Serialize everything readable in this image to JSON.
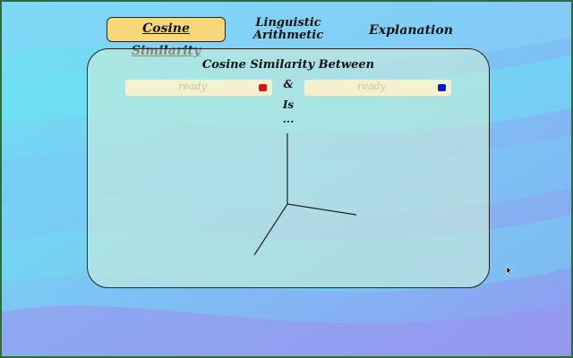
{
  "tabs": [
    {
      "label": "Cosine Similarity",
      "active": true
    },
    {
      "label": "Linguistic Arithmetic",
      "active": false
    },
    {
      "label": "Explanation",
      "active": false
    }
  ],
  "panel": {
    "title": "Cosine Similarity Between",
    "word1": {
      "placeholder": "ready",
      "color": "#e01010"
    },
    "connector": "&",
    "word2": {
      "placeholder": "ready",
      "color": "#0a17d6"
    },
    "is_label": "Is",
    "result": "..."
  },
  "colors": {
    "panel_border": "#222222",
    "active_tab_bg": "#f7d879",
    "input_bg": "#f5f1cf",
    "frame_border": "#2f6b36"
  },
  "icons": {
    "cursor": "arrow-cursor-icon"
  }
}
